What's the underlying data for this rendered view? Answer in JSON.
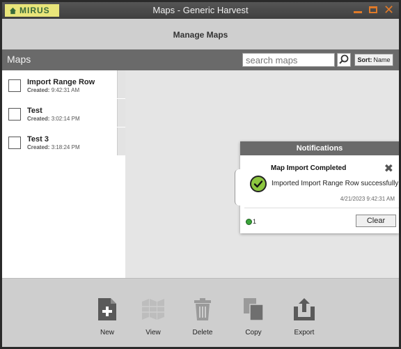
{
  "titlebar": {
    "logo_text": "MIRUS",
    "title": "Maps - Generic Harvest",
    "controls": [
      "minimize-icon",
      "maximize-icon",
      "close-icon"
    ],
    "accent_color": "#e07a28",
    "logo_color": "#e9e57a"
  },
  "header": {
    "title": "Manage Maps"
  },
  "maps_bar": {
    "title": "Maps",
    "search_placeholder": "search maps",
    "search_icon": "search-icon",
    "sort_label": "Sort:",
    "sort_value": "Name"
  },
  "maps": [
    {
      "name": "Import Range Row",
      "created_label": "Created:",
      "created_time": "9:42:31 AM"
    },
    {
      "name": "Test",
      "created_label": "Created:",
      "created_time": "3:02:14 PM"
    },
    {
      "name": "Test 3",
      "created_label": "Created:",
      "created_time": "3:18:24 PM"
    }
  ],
  "notifications": {
    "title": "Notifications",
    "items": [
      {
        "title": "Map Import Completed",
        "message": "Imported Import Range Row successfully",
        "timestamp": "4/21/2023 9:42:31 AM",
        "status_icon": "check-circle-icon",
        "status_color": "#8cc63f"
      }
    ],
    "count": "1",
    "clear_label": "Clear"
  },
  "toolbar": {
    "new_label": "New",
    "view_label": "View",
    "delete_label": "Delete",
    "copy_label": "Copy",
    "export_label": "Export"
  }
}
